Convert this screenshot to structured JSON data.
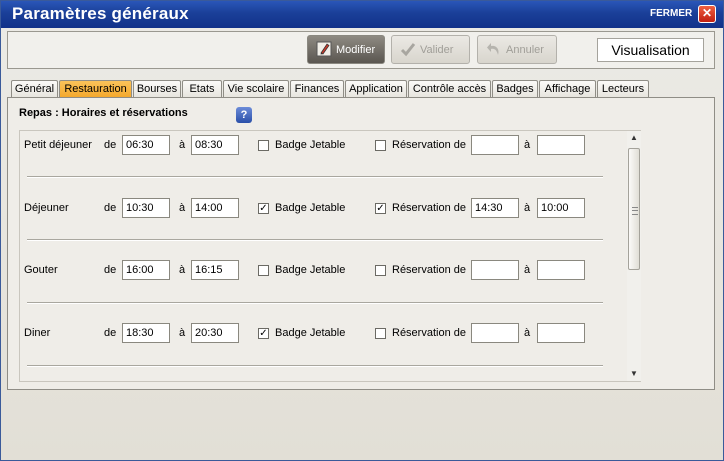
{
  "window": {
    "title": "Paramètres généraux",
    "close_label": "FERMER",
    "close_glyph": "✕"
  },
  "toolbar": {
    "modifier": "Modifier",
    "valider": "Valider",
    "annuler": "Annuler",
    "mode": "Visualisation"
  },
  "tabs": [
    "Général",
    "Restauration",
    "Bourses",
    "Etats",
    "Vie scolaire",
    "Finances",
    "Application",
    "Contrôle accès",
    "Badges",
    "Affichage",
    "Lecteurs"
  ],
  "active_tab": "Restauration",
  "section": {
    "title": "Repas : Horaires et réservations",
    "help": "?"
  },
  "labels": {
    "de": "de",
    "a": "à",
    "badge": "Badge Jetable",
    "reservation": "Réservation de"
  },
  "meals": [
    {
      "name": "Petit déjeuner",
      "from": "06:30",
      "to": "08:30",
      "badge": false,
      "reservation": false,
      "res_from": "",
      "res_to": ""
    },
    {
      "name": "Déjeuner",
      "from": "10:30",
      "to": "14:00",
      "badge": true,
      "reservation": true,
      "res_from": "14:30",
      "res_to": "10:00"
    },
    {
      "name": "Gouter",
      "from": "16:00",
      "to": "16:15",
      "badge": false,
      "reservation": false,
      "res_from": "",
      "res_to": ""
    },
    {
      "name": "Diner",
      "from": "18:30",
      "to": "20:30",
      "badge": true,
      "reservation": false,
      "res_from": "",
      "res_to": ""
    }
  ],
  "colors": {
    "title_bar": "#1a3f98",
    "active_tab": "#f4a72a",
    "close": "#d03018"
  }
}
